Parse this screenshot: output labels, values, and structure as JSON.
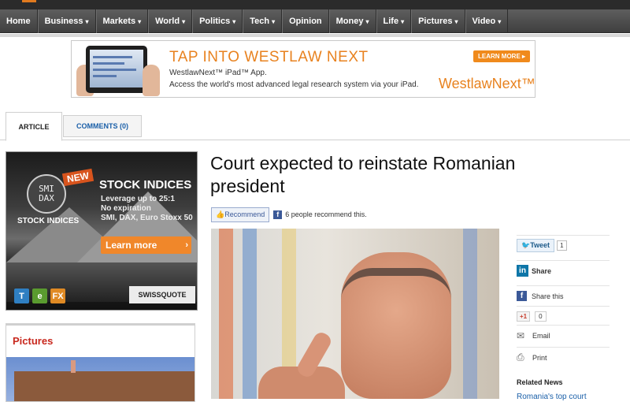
{
  "nav": {
    "items": [
      {
        "label": "Home",
        "dropdown": false
      },
      {
        "label": "Business",
        "dropdown": true
      },
      {
        "label": "Markets",
        "dropdown": true
      },
      {
        "label": "World",
        "dropdown": true
      },
      {
        "label": "Politics",
        "dropdown": true
      },
      {
        "label": "Tech",
        "dropdown": true
      },
      {
        "label": "Opinion",
        "dropdown": false
      },
      {
        "label": "Money",
        "dropdown": true
      },
      {
        "label": "Life",
        "dropdown": true
      },
      {
        "label": "Pictures",
        "dropdown": true
      },
      {
        "label": "Video",
        "dropdown": true
      }
    ],
    "caret": "▾"
  },
  "ad_top": {
    "headline": "TAP INTO WESTLAW NEXT",
    "line1": "WestlawNext™ iPad™ App.",
    "line2": "Access the world's most advanced legal research system via your iPad.",
    "button": "LEARN MORE ▸",
    "brand": "WestlawNext™"
  },
  "tabs": {
    "article": "ARTICLE",
    "comments": "COMMENTS (0)"
  },
  "sidebar_ad": {
    "logo_line1": "SMI",
    "logo_line2": "DAX",
    "badge": "NEW",
    "left_label": "STOCK INDICES",
    "title": "STOCK INDICES",
    "lines": [
      "Leverage up to 25:1",
      "No expiration",
      "SMI, DAX, Euro Stoxx 50"
    ],
    "cta": "Learn more",
    "cta_arrow": "›",
    "icons": [
      {
        "glyph": "T",
        "color": "#2f7fc2",
        "name": "t-app-icon"
      },
      {
        "glyph": "e",
        "color": "#5a9b2f",
        "name": "e-app-icon"
      },
      {
        "glyph": "FX",
        "color": "#e08a24",
        "name": "fx-app-icon"
      }
    ],
    "brand": "SWISSQUOTE"
  },
  "pictures": {
    "header": "Pictures"
  },
  "article": {
    "headline": "Court expected to reinstate Romanian president",
    "recommend_label": "Recommend",
    "recommend_count_text": "6 people recommend this."
  },
  "share": {
    "tweet_label": "Tweet",
    "tweet_count": "1",
    "linkedin_label": "Share",
    "facebook_label": "Share this",
    "gplus_label": "+1",
    "gplus_count": "0",
    "email_label": "Email",
    "print_label": "Print"
  },
  "related": {
    "header": "Related News",
    "first_link": "Romania's top court"
  }
}
